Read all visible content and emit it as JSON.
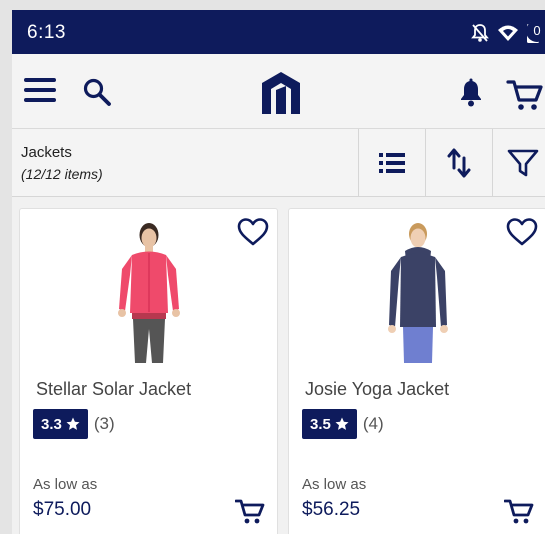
{
  "status_bar": {
    "time": "6:13",
    "icons": [
      "notifications-off-icon",
      "wifi-icon",
      "battery-charging-icon"
    ]
  },
  "app_bar": {
    "icons": [
      "menu-icon",
      "search-icon",
      "store-logo",
      "bell-icon",
      "cart-icon"
    ],
    "cart_count": "0",
    "accent_color": "#0e1b5c"
  },
  "toolbar": {
    "category": "Jackets",
    "item_count": "(12/12 items)",
    "actions": [
      "list-view-icon",
      "sort-icon",
      "filter-icon"
    ]
  },
  "products": [
    {
      "name": "Stellar Solar Jacket",
      "rating": "3.3",
      "review_count": "(3)",
      "price_label": "As low as",
      "price": "$75.00",
      "image_color": "#ef4a6b"
    },
    {
      "name": "Josie Yoga Jacket",
      "rating": "3.5",
      "review_count": "(4)",
      "price_label": "As low as",
      "price": "$56.25",
      "image_color": "#3b4266"
    }
  ]
}
